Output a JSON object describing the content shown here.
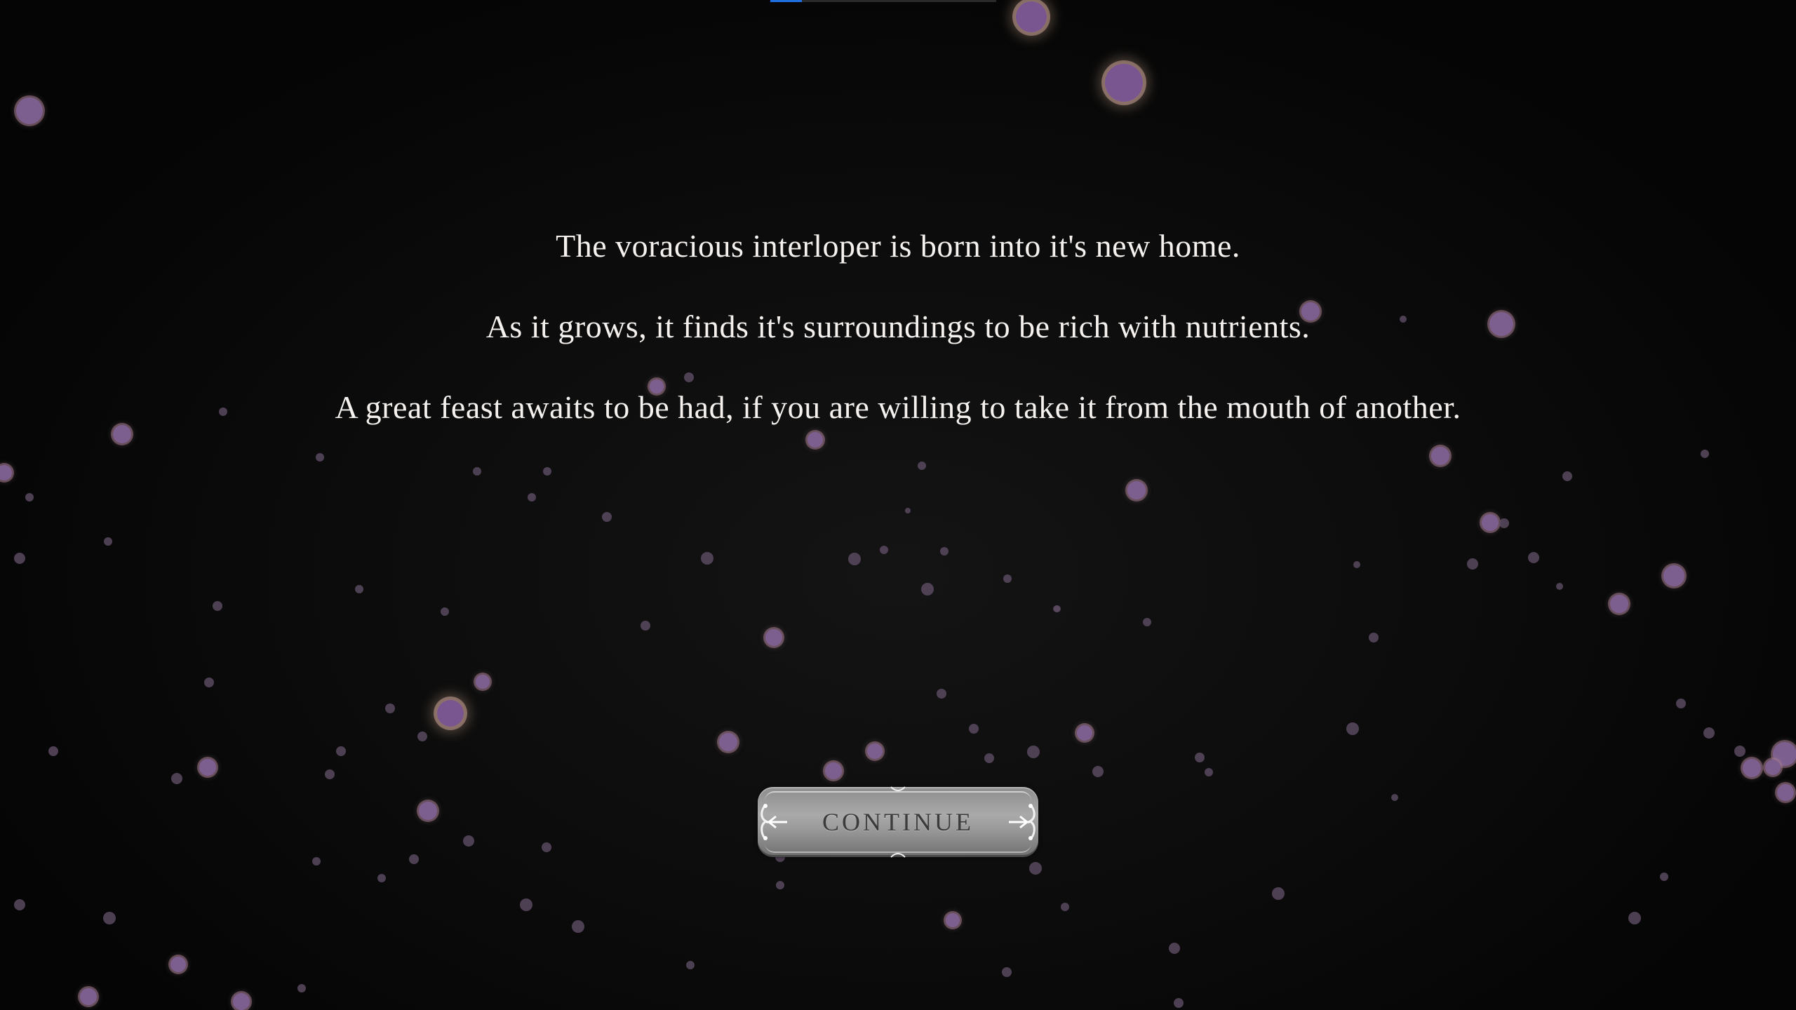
{
  "story": {
    "lines": [
      "The voracious interloper is born into it's new home.",
      "As it grows, it finds it's surroundings to be rich with nutrients.",
      "A great feast awaits to be had, if you are willing to take it from the mouth of another."
    ]
  },
  "continue_button": {
    "label": "CONTINUE"
  },
  "progress": {
    "fraction": 0.14,
    "color": "#1f6fe0"
  },
  "colors": {
    "background": "#070707",
    "text": "#f4f1ee",
    "particle": "#7d5f8f",
    "particle_glow": "#e6bea0",
    "button": "#a9a9a9"
  },
  "icons": {
    "button_ornament": "filigree-arrow-icon",
    "particles": "glowing-spore-icon"
  }
}
